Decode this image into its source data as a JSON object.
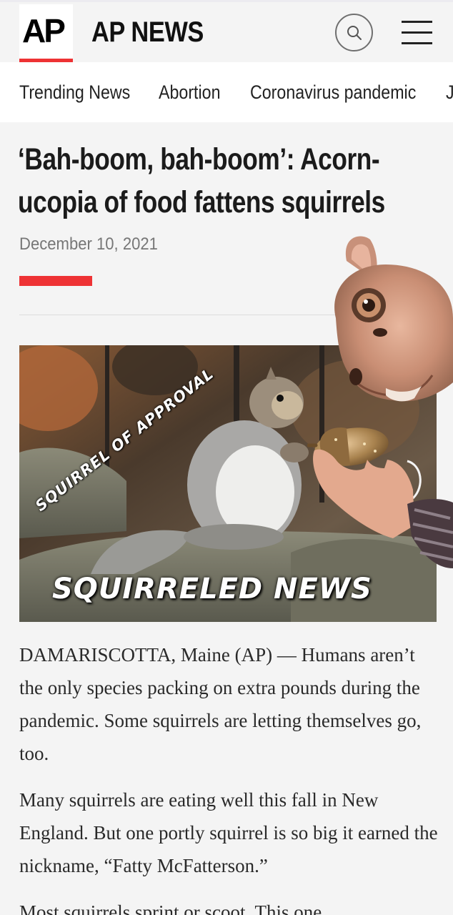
{
  "header": {
    "logo_text": "AP",
    "brand": "AP NEWS",
    "search_icon": "search-icon",
    "menu_icon": "hamburger-menu-icon"
  },
  "nav": {
    "items": [
      {
        "label": "Trending News"
      },
      {
        "label": "Abortion"
      },
      {
        "label": "Coronavirus pandemic"
      },
      {
        "label": "J"
      }
    ]
  },
  "article": {
    "headline_line1": "‘Bah-boom, bah-boom’: Acorn-",
    "headline_line2": "ucopia of food fattens squirrels",
    "date": "December 10, 2021",
    "photo": {
      "caption_top": "SQUIRREL OF APPROVAL",
      "caption_bottom": "SQUIRRELED NEWS"
    },
    "paragraphs": [
      "DAMARISCOTTA, Maine (AP) — Humans aren’t the only species packing on extra pounds during the pandemic. Some squirrels are letting themselves go, too.",
      "Many squirrels are eating well this fall in New England. But one portly squirrel is so big it earned the nickname, “Fatty McFatterson.”",
      "Most squirrels sprint or scoot. This one"
    ]
  },
  "colors": {
    "accent": "#ee3234",
    "background": "#f4f4f4",
    "text": "#1b1b1b"
  }
}
